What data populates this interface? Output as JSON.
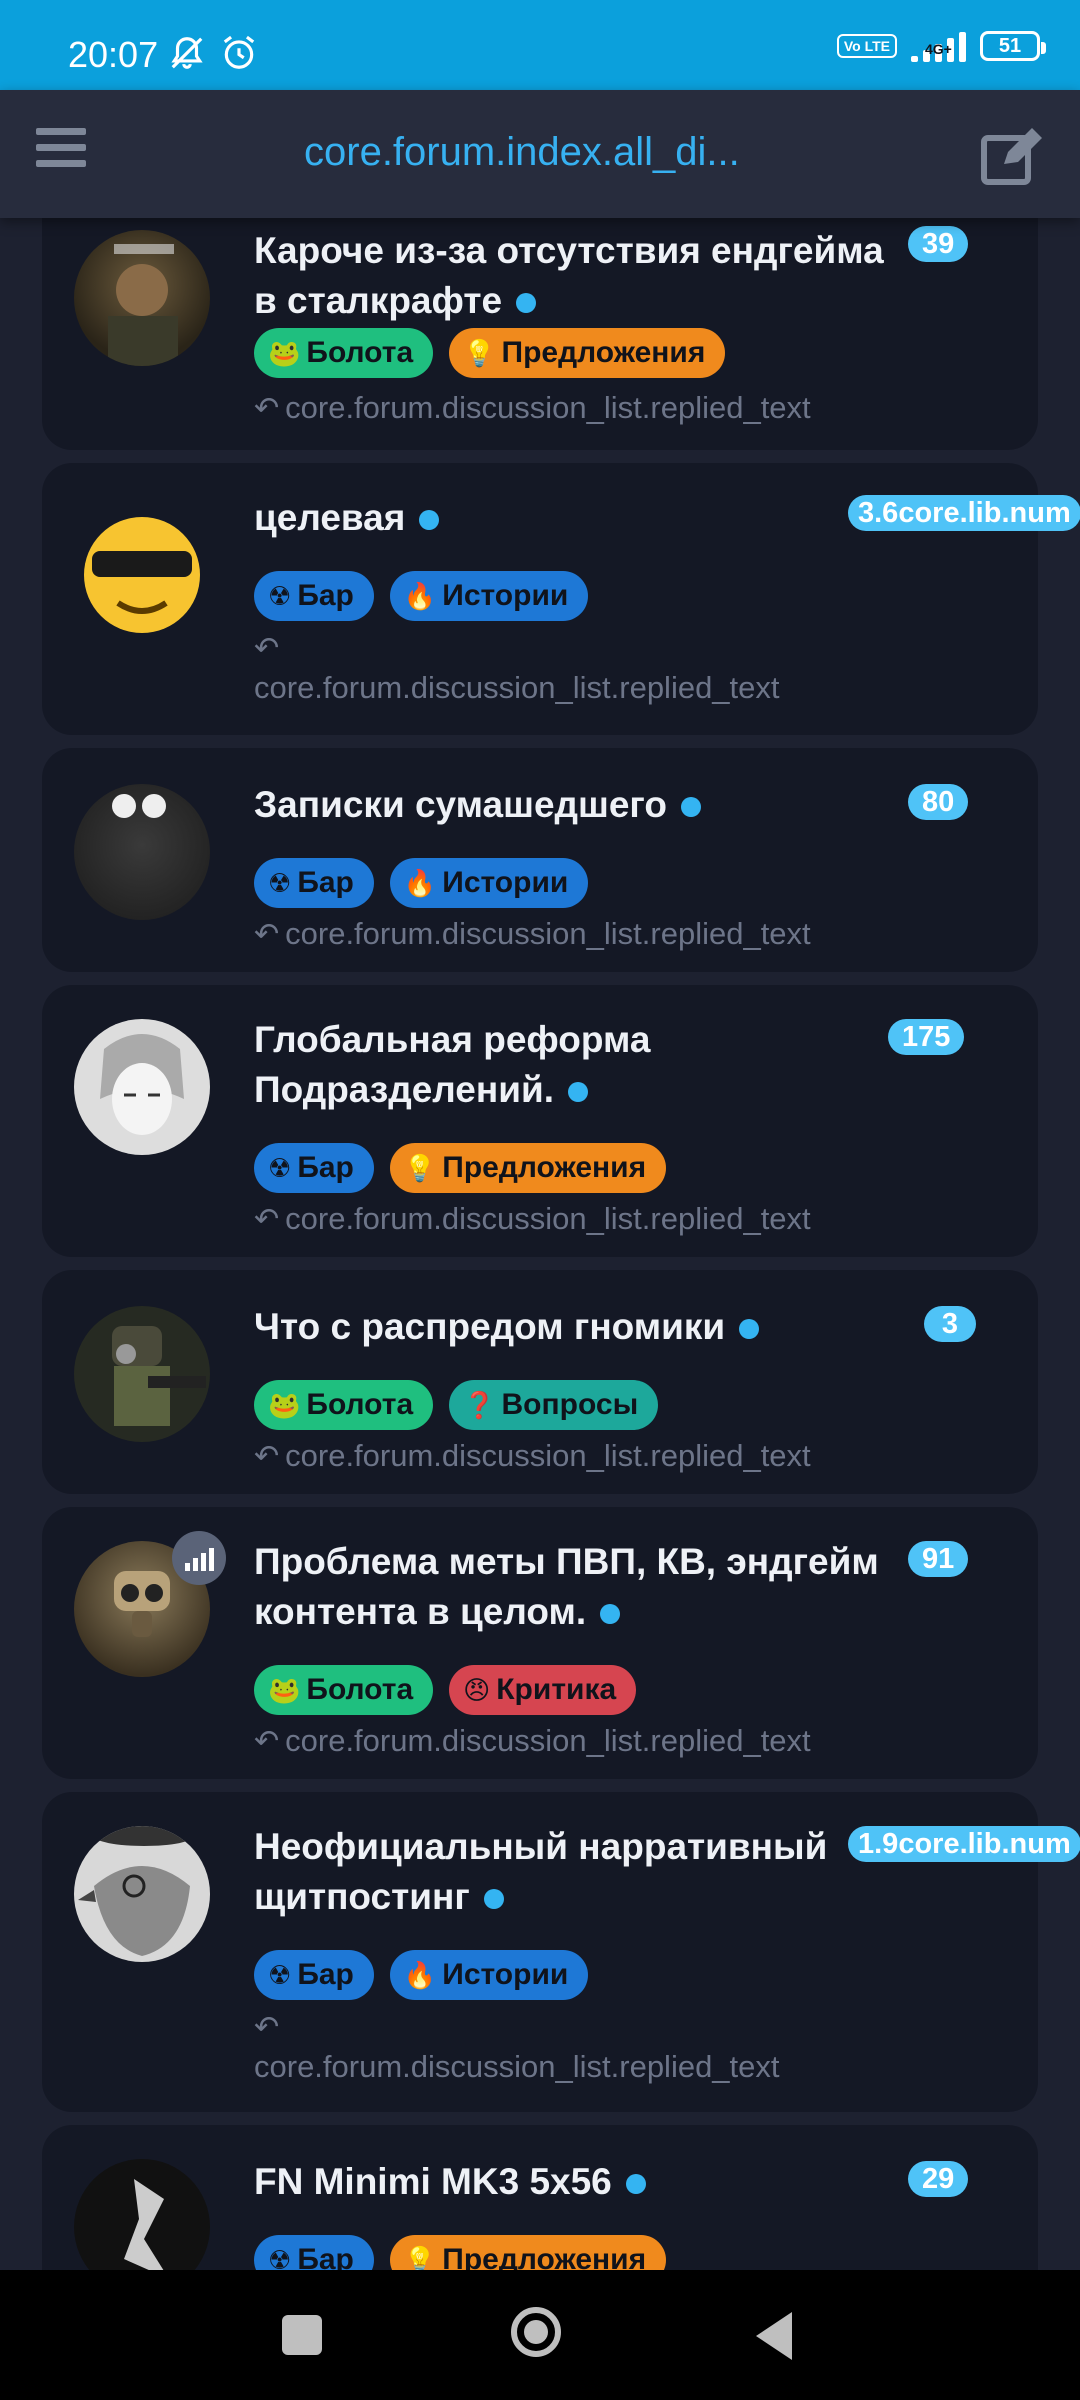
{
  "status_bar": {
    "time": "20:07",
    "network": "4G+",
    "volte": "Vo LTE",
    "battery": "51"
  },
  "app_bar": {
    "title": "core.forum.index.all_di..."
  },
  "reply_text": "core.forum.discussion_list.replied_text",
  "discussions": [
    {
      "title": "Кароче из-за отсутствия ендгейма в сталкрафте",
      "count": "39",
      "tags": [
        {
          "label": "Болота",
          "color": "green",
          "icon": "frog-icon"
        },
        {
          "label": "Предложения",
          "color": "orange",
          "icon": "lightbulb-icon"
        }
      ]
    },
    {
      "title": "целевая",
      "count": "3.6core.lib.num",
      "tags": [
        {
          "label": "Бар",
          "color": "blue",
          "icon": "radiation-icon"
        },
        {
          "label": "Истории",
          "color": "blue",
          "icon": "flame-icon"
        }
      ]
    },
    {
      "title": "Записки сумашедшего",
      "count": "80",
      "tags": [
        {
          "label": "Бар",
          "color": "blue",
          "icon": "radiation-icon"
        },
        {
          "label": "Истории",
          "color": "blue",
          "icon": "flame-icon"
        }
      ]
    },
    {
      "title": "Глобальная реформа Подразделений.",
      "count": "175",
      "tags": [
        {
          "label": "Бар",
          "color": "blue",
          "icon": "radiation-icon"
        },
        {
          "label": "Предложения",
          "color": "orange",
          "icon": "lightbulb-icon"
        }
      ]
    },
    {
      "title": "Что с распредом гномики",
      "count": "3",
      "tags": [
        {
          "label": "Болота",
          "color": "green",
          "icon": "frog-icon"
        },
        {
          "label": "Вопросы",
          "color": "teal",
          "icon": "question-icon"
        }
      ]
    },
    {
      "title": "Проблема меты ПВП, КВ, эндгейм контента в целом.",
      "count": "91",
      "tags": [
        {
          "label": "Болота",
          "color": "green",
          "icon": "frog-icon"
        },
        {
          "label": "Критика",
          "color": "red",
          "icon": "angry-face-icon"
        }
      ]
    },
    {
      "title": "Неофициальный нарративный щитпостинг",
      "count": "1.9core.lib.num",
      "tags": [
        {
          "label": "Бар",
          "color": "blue",
          "icon": "radiation-icon"
        },
        {
          "label": "Истории",
          "color": "blue",
          "icon": "flame-icon"
        }
      ]
    },
    {
      "title": "FN Minimi MK3 5x56",
      "count": "29",
      "tags": [
        {
          "label": "Бар",
          "color": "blue",
          "icon": "radiation-icon"
        },
        {
          "label": "Предложения",
          "color": "orange",
          "icon": "lightbulb-icon"
        }
      ]
    }
  ],
  "colors": {
    "accent": "#37b1f1",
    "status_bar": "#0ba0dc",
    "card": "#141825",
    "background": "#1d2130"
  }
}
